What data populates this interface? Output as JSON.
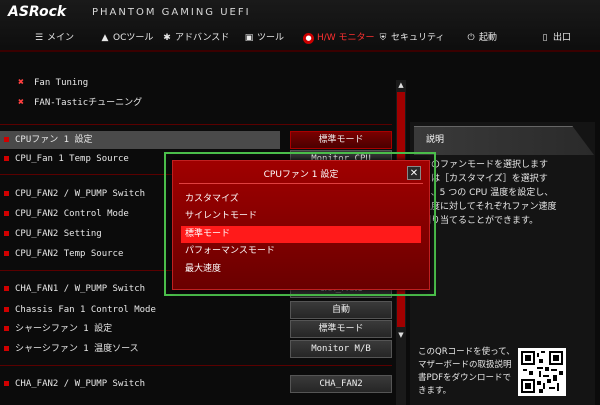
{
  "header": {
    "brand": "ASRock",
    "brand_sub": "PHANTOM GAMING UEFI",
    "nav": [
      {
        "label": "メイン",
        "icon": "menu-icon"
      },
      {
        "label": "OCツール",
        "icon": "flame-icon"
      },
      {
        "label": "アドバンスド",
        "icon": "star-icon"
      },
      {
        "label": "ツール",
        "icon": "toolbox-icon"
      },
      {
        "label": "H/W モニター",
        "icon": "monitor-icon",
        "active": true
      },
      {
        "label": "セキュリティ",
        "icon": "shield-icon"
      },
      {
        "label": "起動",
        "icon": "power-icon"
      },
      {
        "label": "出口",
        "icon": "exit-icon"
      }
    ]
  },
  "left": {
    "fan_tuning": "Fan Tuning",
    "fan_tastic": "FAN-Tasticチューニング",
    "rows": [
      {
        "label": "CPUファン 1 設定",
        "value": "標準モード"
      },
      {
        "label": "CPU_Fan 1 Temp Source",
        "value": "Monitor CPU"
      },
      {
        "label": "CPU_FAN2 / W_PUMP Switch",
        "value": ""
      },
      {
        "label": "CPU_FAN2 Control Mode",
        "value": ""
      },
      {
        "label": "CPU_FAN2 Setting",
        "value": ""
      },
      {
        "label": "CPU_FAN2 Temp Source",
        "value": ""
      },
      {
        "label": "CHA_FAN1 / W_PUMP Switch",
        "value": "CHA_FAN1"
      },
      {
        "label": "Chassis Fan 1 Control Mode",
        "value": "自動"
      },
      {
        "label": "シャーシファン 1 設定",
        "value": "標準モード"
      },
      {
        "label": "シャーシファン 1 温度ソース",
        "value": "Monitor M/B"
      },
      {
        "label": "CHA_FAN2 / W_PUMP Switch",
        "value": "CHA_FAN2"
      }
    ]
  },
  "description": {
    "title": "説明",
    "text": "ンのファンモードを選択します\nたは［カスタマイズ］を選択す\nと、5 つの CPU 温度を設定し、\n温度に対してそれぞれファン速度\n割り当てることができます。",
    "qr_text": "このQRコードを使って、マザーボードの取扱説明書PDFをダウンロードできます。"
  },
  "modal": {
    "title": "CPUファン 1 設定",
    "close": "✕",
    "options": [
      "カスタマイズ",
      "サイレントモード",
      "標準モード",
      "パフォーマンスモード",
      "最大速度"
    ],
    "selected_index": 2
  },
  "colors": {
    "accent": "#d00000",
    "highlight": "#ff1a1a",
    "frame": "#4bbf4b"
  }
}
